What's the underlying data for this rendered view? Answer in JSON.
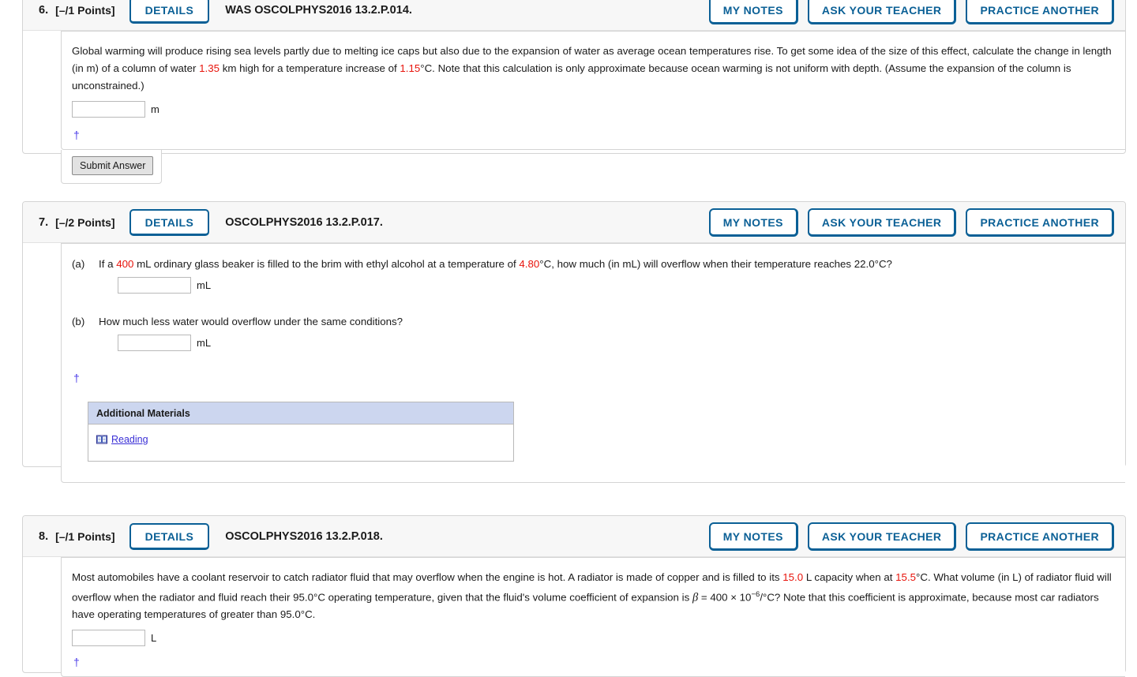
{
  "colors": {
    "accent_blue": "#0b6096",
    "highlight_red": "#e8140c",
    "link_purple": "#3a2fd6",
    "dagger_blue": "#4b3ce8",
    "header_bg": "#f7f7f7",
    "addmat_head_bg": "#ccd6ef"
  },
  "common": {
    "details_label": "DETAILS",
    "my_notes_label": "MY NOTES",
    "ask_teacher_label": "ASK YOUR TEACHER",
    "practice_another_label": "PRACTICE ANOTHER",
    "submit_label": "Submit Answer",
    "dagger": "†"
  },
  "questions": [
    {
      "number": "6.",
      "points": "[–/1 Points]",
      "code": "WAS OSCOLPHYS2016 13.2.P.014.",
      "prompt": {
        "seg1": "Global warming will produce rising sea levels partly due to melting ice caps but also due to the expansion of water as average ocean temperatures rise. To get some idea of the size of this effect, calculate the change in length (in m) of a column of water ",
        "val1": "1.35",
        "seg2": " km high for a temperature increase of ",
        "val2": "1.15",
        "seg3": "°C. Note that this calculation is only approximate because ocean warming is not uniform with depth. (Assume the expansion of the column is unconstrained.)"
      },
      "answer_unit": "m",
      "answer_value": "",
      "has_submit": true
    },
    {
      "number": "7.",
      "points": "[–/2 Points]",
      "code": "OSCOLPHYS2016 13.2.P.017.",
      "parts": [
        {
          "label": "(a)",
          "seg1": "If a ",
          "val1": "400",
          "seg2": " mL ordinary glass beaker is filled to the brim with ethyl alcohol at a temperature of ",
          "val2": "4.80",
          "seg3": "°C, how much (in mL) will overflow when their temperature reaches 22.0°C?",
          "unit": "mL",
          "value": ""
        },
        {
          "label": "(b)",
          "seg1": "How much less water would overflow under the same conditions?",
          "val1": "",
          "seg2": "",
          "val2": "",
          "seg3": "",
          "unit": "mL",
          "value": ""
        }
      ],
      "additional_materials": {
        "title": "Additional Materials",
        "items": [
          {
            "icon": "book-icon",
            "label": "Reading"
          }
        ]
      }
    },
    {
      "number": "8.",
      "points": "[–/1 Points]",
      "code": "OSCOLPHYS2016 13.2.P.018.",
      "prompt": {
        "seg1": "Most automobiles have a coolant reservoir to catch radiator fluid that may overflow when the engine is hot. A radiator is made of copper and is filled to its ",
        "val1": "15.0",
        "seg2": " L capacity when at ",
        "val2": "15.5",
        "seg3": "°C. What volume (in L) of radiator fluid will overflow when the radiator and fluid reach their 95.0°C operating temperature, given that the fluid's volume coefficient of expansion is ",
        "beta": "β",
        "seg4": " = 400 × 10",
        "exponent": "−6",
        "seg5": "/°C? Note that this coefficient is approximate, because most car radiators have operating temperatures of greater than 95.0°C.",
        "answer_unit": "L",
        "answer_value": ""
      }
    }
  ]
}
